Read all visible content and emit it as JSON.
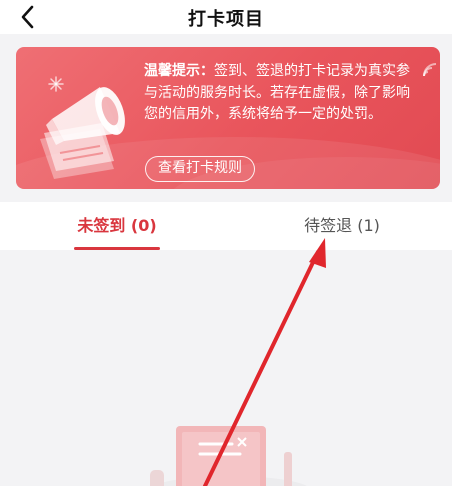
{
  "header": {
    "title": "打卡项目",
    "back_icon": "chevron-left-icon"
  },
  "banner": {
    "notice_label": "温馨提示：",
    "notice_text": "签到、签退的打卡记录为真实参与活动的服务时长。若存在虚假，除了影响您的信用外，系统将给予一定的处罚。",
    "rules_button": "查看打卡规则",
    "colors": {
      "start": "#ef6f74",
      "end": "#e14a52"
    }
  },
  "tabs": [
    {
      "label": "未签到 (0)",
      "active": true
    },
    {
      "label": "待签退 (1)",
      "active": false
    }
  ],
  "colors": {
    "accent": "#d9363e",
    "annotation_arrow": "#e0262c"
  }
}
